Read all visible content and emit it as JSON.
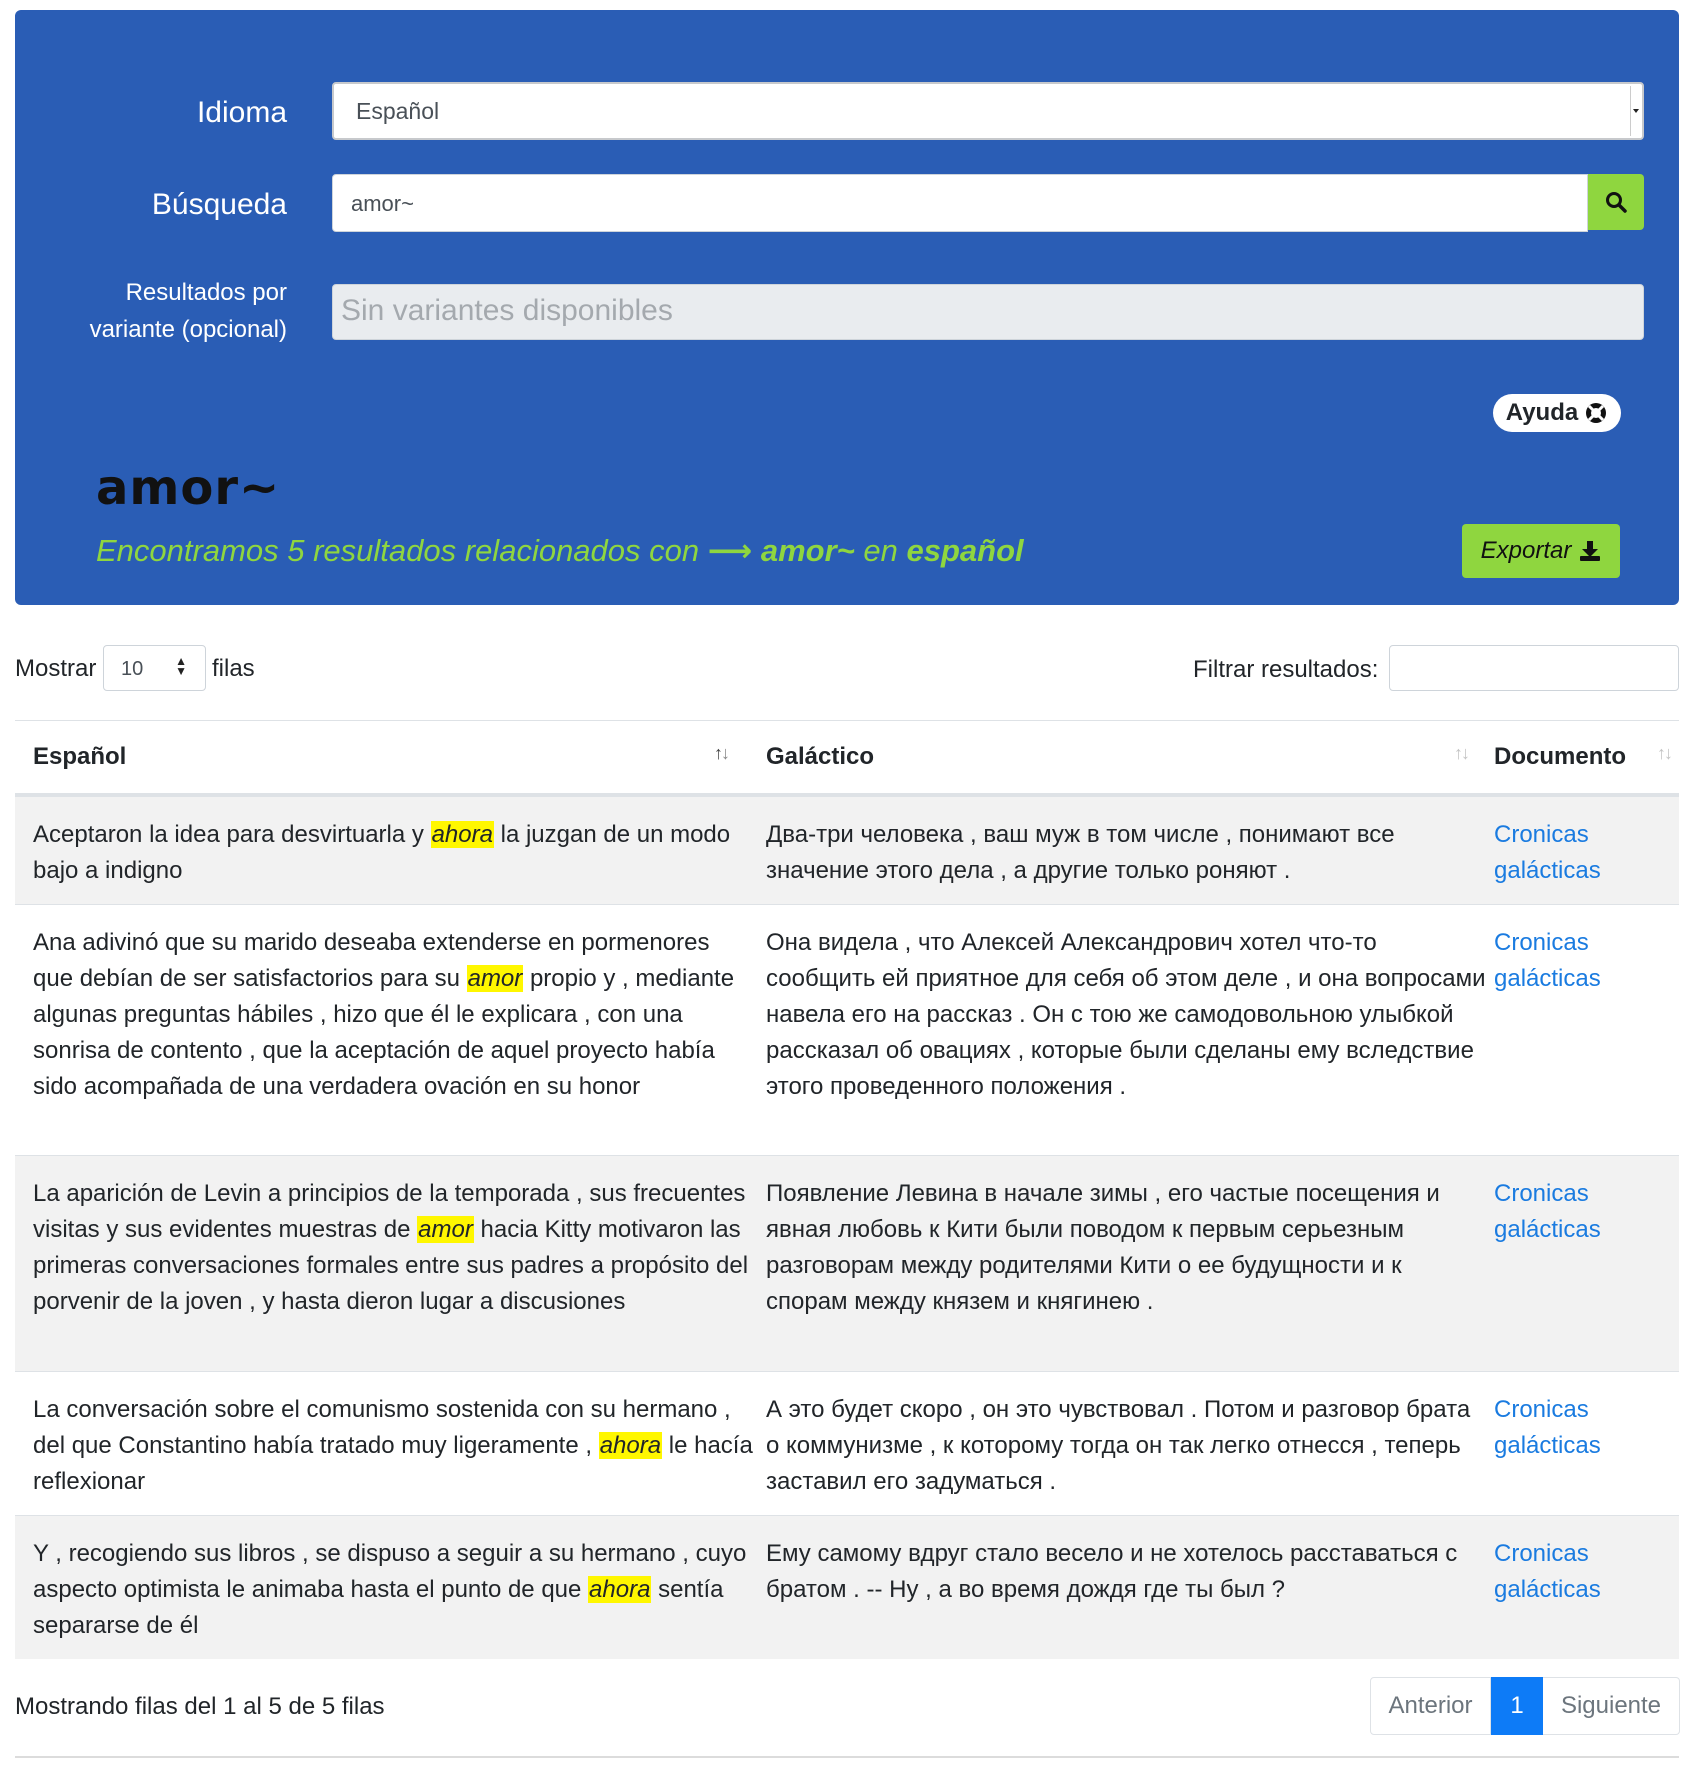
{
  "search": {
    "language_label": "Idioma",
    "language_value": "Español",
    "query_label": "Búsqueda",
    "query_value": "amor~",
    "variants_label_line1": "Resultados por",
    "variants_label_line2": "variante (opcional)",
    "variants_placeholder": "Sin variantes disponibles",
    "help_label": "Ayuda"
  },
  "results_header": {
    "title": "amor~",
    "summary_prefix": "Encontramos 5 resultados relacionados con",
    "summary_arrow": "⟶",
    "summary_term": "amor~",
    "summary_mid": "en",
    "summary_lang": "español",
    "export_label": "Exportar"
  },
  "controls": {
    "show_label": "Mostrar",
    "rows_value": "10",
    "rows_suffix": "filas",
    "filter_label": "Filtrar resultados:"
  },
  "table": {
    "headers": [
      "Español",
      "Galáctico",
      "Documento"
    ],
    "rows": [
      {
        "es_before": "Aceptaron la idea para desvirtuarla y ",
        "es_hit": "ahora",
        "es_after": " la juzgan de un modo bajo a indigno",
        "gal": "Два-три человека , ваш муж в том числе , понимают все значение этого дела , а другие только роняют .",
        "doc": "Cronicas galácticas"
      },
      {
        "es_before": "Ana adivinó que su marido deseaba extenderse en pormenores que debían de ser satisfactorios para su ",
        "es_hit": "amor",
        "es_after": " propio y , mediante algunas preguntas hábiles , hizo que él le explicara , con una sonrisa de contento , que la aceptación de aquel proyecto había sido acompañada de una verdadera ovación en su honor",
        "gal": "Она видела , что Алексей Александрович хотел что-то сообщить ей приятное для себя об этом деле , и она вопросами навела его на рассказ . Он с тою же самодовольною улыбкой рассказал об овациях , которые были сделаны ему вследствие этого проведенного положения .",
        "doc": "Cronicas galácticas"
      },
      {
        "es_before": "La aparición de Levin a principios de la temporada , sus frecuentes visitas y sus evidentes muestras de ",
        "es_hit": "amor",
        "es_after": " hacia Kitty motivaron las primeras conversaciones formales entre sus padres a propósito del porvenir de la joven , y hasta dieron lugar a discusiones",
        "gal": "Появление Левина в начале зимы , его частые посещения и явная любовь к Кити были поводом к первым серьезным разговорам между родителями Кити о ее будущности и к спорам между князем и княгинею .",
        "doc": "Cronicas galácticas"
      },
      {
        "es_before": "La conversación sobre el comunismo sostenida con su hermano , del que Constantino había tratado muy ligeramente , ",
        "es_hit": "ahora",
        "es_after": " le hacía reflexionar",
        "gal": "А это будет скоро , он это чувствовал . Потом и разговор брата о коммунизме , к которому тогда он так легко отнесся , теперь заставил его задуматься .",
        "doc": "Cronicas galácticas"
      },
      {
        "es_before": "Y , recogiendo sus libros , se dispuso a seguir a su hermano , cuyo aspecto optimista le animaba hasta el punto de que ",
        "es_hit": "ahora",
        "es_after": " sentía separarse de él",
        "gal": "Ему самому вдруг стало весело и не хотелось расставаться с братом . -- Ну , а во время дождя где ты был ?",
        "doc": "Cronicas galácticas"
      }
    ]
  },
  "footer": {
    "info": "Mostrando filas del 1 al 5 de 5 filas",
    "prev_label": "Anterior",
    "current_page": "1",
    "next_label": "Siguiente"
  }
}
